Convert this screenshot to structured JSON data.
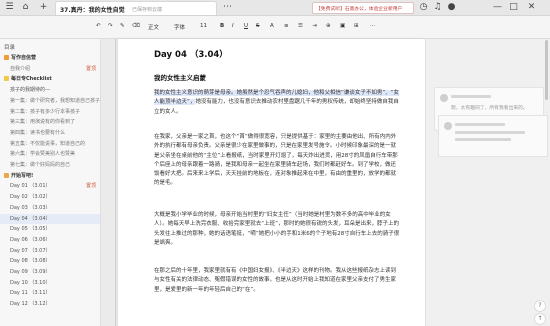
{
  "topbar": {
    "doc_title": "37.真丹：我的女性自觉",
    "save_status": "已保存到云端",
    "banner_text": "【免费试听】石墨办公，体验企业新用户",
    "share_label": "分享"
  },
  "toolbar": {
    "style_select": "正文",
    "font_select": "字体",
    "size_select": "11",
    "bold": "B",
    "italic": "I",
    "underline": "U",
    "strike": "S",
    "align": "≡",
    "list": "☰",
    "link": "🔗",
    "more": "···"
  },
  "sidebar": {
    "title": "目录",
    "items": [
      {
        "label": "写作自信营",
        "badge": ""
      },
      {
        "label": "自我介绍",
        "badge": "置顶"
      },
      {
        "label": "每日专Checklist",
        "badge": ""
      },
      {
        "label": "孩子的我期待的—",
        "badge": ""
      },
      {
        "label": "第一集：做个研究者，我想知道自己孩子",
        "badge": ""
      },
      {
        "label": "第二集：孩子有多少行本事孩子",
        "badge": ""
      },
      {
        "label": "第三集：用演说有的你看到了",
        "badge": ""
      },
      {
        "label": "第四集：读书也要有什么",
        "badge": ""
      },
      {
        "label": "第五集：不仅能说事，知道自己的",
        "badge": ""
      },
      {
        "label": "第六集：学会赞美别人也赞美",
        "badge": ""
      },
      {
        "label": "第七集：做个好妈妈的自己",
        "badge": ""
      },
      {
        "label": "开始写吧!",
        "badge": ""
      },
      {
        "label": "Day 01 （3.01）",
        "badge": "置顶"
      },
      {
        "label": "Day 02 （3.02）",
        "badge": ""
      },
      {
        "label": "Day 03 （3.03）",
        "badge": ""
      },
      {
        "label": "Day 04 （3.04）",
        "badge": ""
      },
      {
        "label": "Day 05 （3.05）",
        "badge": ""
      },
      {
        "label": "Day 06 （3.06）",
        "badge": ""
      },
      {
        "label": "Day 07 （3.07）",
        "badge": ""
      },
      {
        "label": "Day 08 （3.08）",
        "badge": ""
      },
      {
        "label": "Day 09 （3.09）",
        "badge": ""
      },
      {
        "label": "Day 10 （3.10）",
        "badge": ""
      },
      {
        "label": "Day 11 （3.11）",
        "badge": ""
      },
      {
        "label": "Day 12 （3.12）",
        "badge": ""
      }
    ]
  },
  "doc": {
    "heading": "Day 04 （3.04）",
    "subheading": "我的女性主义启蒙",
    "p1_highlight": "我的女性主义意识的萌芽是母亲。她虽然是个忍气吞声的儿媳妇，他和父相信“谦谈女子不如男”、“女人能顶半边天”，",
    "p1_rest": "她没有能力，也没有意识去推动农村里盘踞几千年的男权传统，却始终坚持做自我自立的女人。",
    "p2": "在我家，父亲是一家之首，也这个“首”做得很宽容，只是提供基于：家里的主要由他出、所有内内外外的执行都有母亲负责。父亲是很少在家里做事的，只是在家里发号施令。小时候印象最深的是一就是父亲坐在桌前他的“主位”上看报纸，当时家里开灯熄了，每天炸出进货，用28寸的凤凰自行车带那个后座上的母亲跟着一路骑，是我和母亲一起坐在家里骑车赶场，我们时都赶好车。到了学校，做还饭看好大把。后来来上学后，天天挂前的地板在，连对象推起来在中里，有由的重里的，放学的都就的是毛。",
    "p3": "大概是我小学毕业的时候，母亲开始当村里的“妇女主任”（当时她是村里为数不多的高中毕业的女人）。她每天早上洗完衣服、收拾完家里就去“上班”，那时的她很有锐的头发，耳朵是出来，脖子上的头发往上推过的那种，她的话语笔挺，“嗬”她把小小的手和1米6的个子地有28寸自行车上去的骑子很是飒爽。",
    "p4": "在那之后的十年里，我家里就有有《中国妇女报》、《半边天》这样的刊物。我从这些报纸杂志上读到与女性有关的法律动态、冤假错误的女性的故事，也是从这时开始上我知道在家里父亲支付了男生家里，是爱里的新一年的年轻后自己的“在”。"
  },
  "comments": [
    {
      "text": "嗯，太有趣同了，所有我看出来的。"
    },
    {
      "text": ""
    }
  ]
}
